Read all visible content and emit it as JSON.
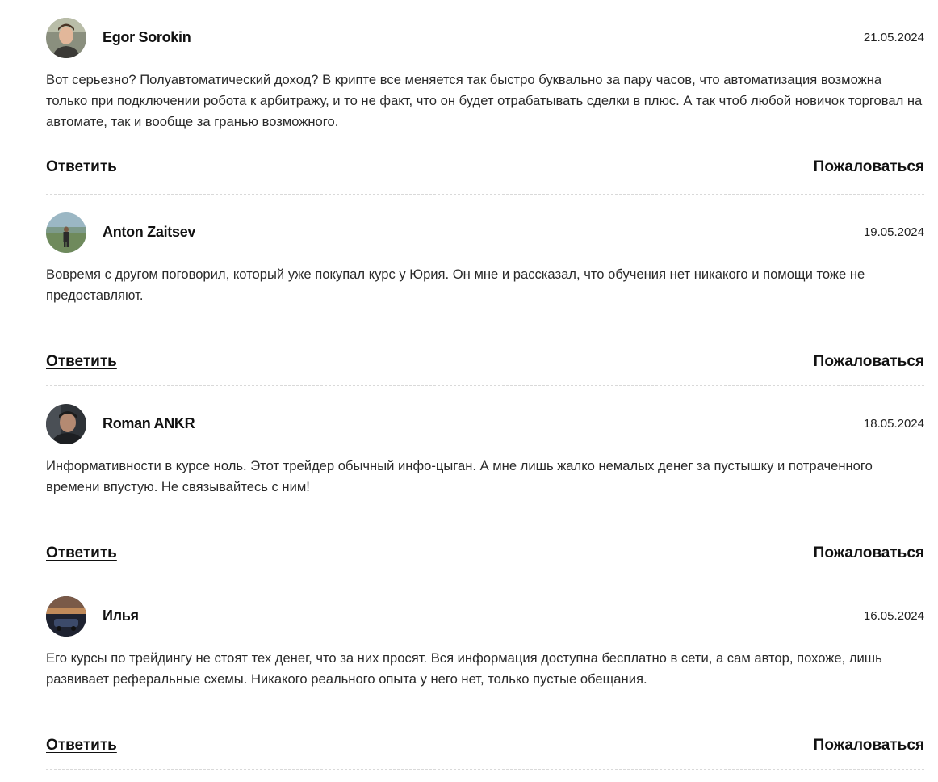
{
  "comments": [
    {
      "author": "Egor Sorokin",
      "date": "21.05.2024",
      "text": "Вот серьезно? Полуавтоматический доход? В крипте все меняется так быстро буквально за пару часов, что автоматизация возможна только при подключении робота к арбитражу, и то не факт, что он будет отрабатывать сделки в плюс. А так чтоб любой новичок торговал на автомате, так и вообще за гранью возможного.",
      "reply_label": "Ответить",
      "report_label": "Пожаловаться"
    },
    {
      "author": "Anton Zaitsev",
      "date": "19.05.2024",
      "text": "Вовремя с другом поговорил, который уже покупал курс у Юрия. Он мне и рассказал, что обучения нет никакого и помощи тоже не предоставляют.",
      "reply_label": "Ответить",
      "report_label": "Пожаловаться"
    },
    {
      "author": "Roman ANKR",
      "date": "18.05.2024",
      "text": "Информативности в курсе ноль. Этот трейдер обычный инфо-цыган. А мне лишь жалко немалых денег за пустышку и потраченного времени впустую. Не связывайтесь с ним!",
      "reply_label": "Ответить",
      "report_label": "Пожаловаться"
    },
    {
      "author": "Илья",
      "date": "16.05.2024",
      "text": "Его курсы по трейдингу не стоят тех денег, что за них просят. Вся информация доступна бесплатно в сети, а сам автор, похоже, лишь развивает реферальные схемы. Никакого реального опыта у него нет, только пустые обещания.",
      "reply_label": "Ответить",
      "report_label": "Пожаловаться"
    }
  ]
}
